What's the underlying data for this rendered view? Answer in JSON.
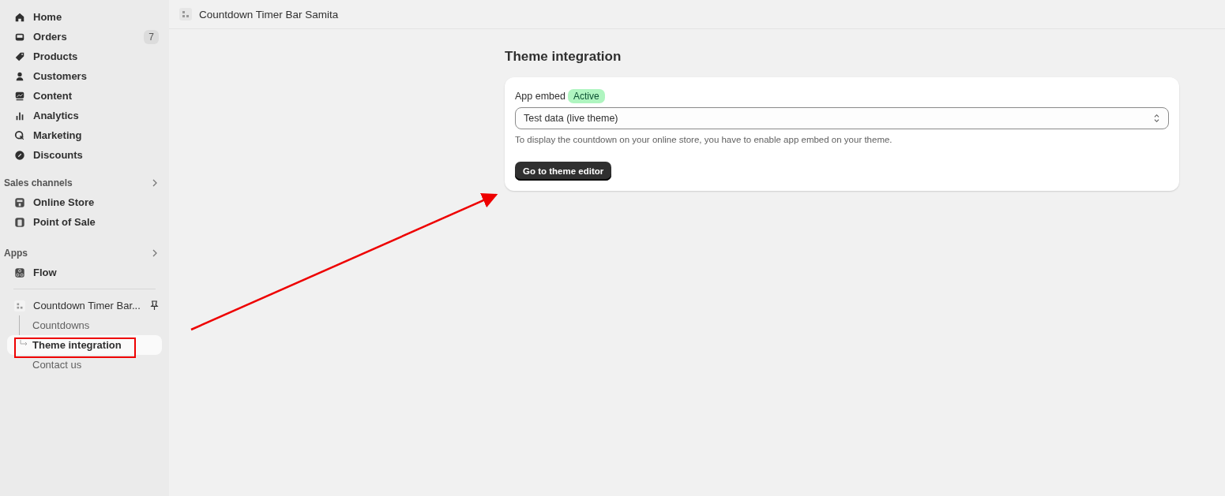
{
  "sidebar": {
    "items": [
      {
        "label": "Home"
      },
      {
        "label": "Orders",
        "badge": "7"
      },
      {
        "label": "Products"
      },
      {
        "label": "Customers"
      },
      {
        "label": "Content"
      },
      {
        "label": "Analytics"
      },
      {
        "label": "Marketing"
      },
      {
        "label": "Discounts"
      }
    ],
    "sections": [
      {
        "title": "Sales channels",
        "items": [
          {
            "label": "Online Store"
          },
          {
            "label": "Point of Sale"
          }
        ]
      },
      {
        "title": "Apps",
        "items": [
          {
            "label": "Flow"
          }
        ]
      }
    ],
    "app": {
      "label": "Countdown Timer Bar...",
      "children": [
        {
          "label": "Countdowns",
          "selected": false
        },
        {
          "label": "Theme integration",
          "selected": true
        },
        {
          "label": "Contact us",
          "selected": false
        }
      ]
    }
  },
  "top_bar": {
    "title": "Countdown Timer Bar Samita"
  },
  "page": {
    "title": "Theme integration",
    "card": {
      "label": "App embed",
      "status": "Active",
      "select_value": "Test data (live theme)",
      "help": "To display the countdown on your online store, you have to enable app embed on your theme.",
      "button": "Go to theme editor"
    }
  }
}
